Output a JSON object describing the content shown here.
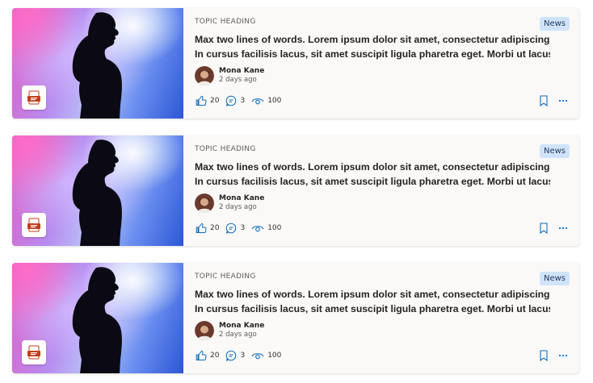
{
  "cards": [
    {
      "topic": "TOPIC HEADING",
      "badge": "News",
      "title_line1": "Max two lines of words. Lorem ipsum dolor sit amet, consectetur adipiscing elit.",
      "title_line2": "In cursus facilisis lacus, sit amet suscipit ligula pharetra eget. Morbi ut lacus in...",
      "author": "Mona Kane",
      "time": "2 days ago",
      "likes": "20",
      "comments": "3",
      "views": "100"
    },
    {
      "topic": "TOPIC HEADING",
      "badge": "News",
      "title_line1": "Max two lines of words. Lorem ipsum dolor sit amet, consectetur adipiscing elit.",
      "title_line2": "In cursus facilisis lacus, sit amet suscipit ligula pharetra eget. Morbi ut lacus in...",
      "author": "Mona Kane",
      "time": "2 days ago",
      "likes": "20",
      "comments": "3",
      "views": "100"
    },
    {
      "topic": "TOPIC HEADING",
      "badge": "News",
      "title_line1": "Max two lines of words. Lorem ipsum dolor sit amet, consectetur adipiscing elit.",
      "title_line2": "In cursus facilisis lacus, sit amet suscipit ligula pharetra eget. Morbi ut lacus in...",
      "author": "Mona Kane",
      "time": "2 days ago",
      "likes": "20",
      "comments": "3",
      "views": "100"
    }
  ],
  "icons": {
    "file": "powerpoint-file-icon",
    "like": "thumbs-up-icon",
    "comment": "comment-icon",
    "view": "eye-icon",
    "bookmark": "bookmark-icon",
    "more": "more-options-icon"
  },
  "colors": {
    "card_bg": "#faf9f8",
    "accent_blue": "#0f6cbd",
    "badge_bg": "#cfe4fa",
    "file_red": "#c43e1c"
  }
}
